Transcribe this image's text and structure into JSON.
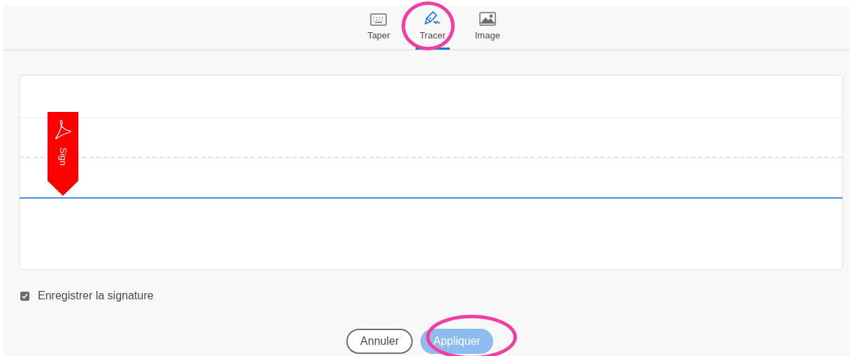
{
  "tabs": [
    {
      "label": "Taper",
      "kind": "keyboard",
      "selected": false
    },
    {
      "label": "Tracer",
      "kind": "pen",
      "selected": true
    },
    {
      "label": "Image",
      "kind": "image",
      "selected": false
    }
  ],
  "badge": {
    "label": "Sign"
  },
  "save_signature": {
    "label": "Enregistrer la signature",
    "checked": true
  },
  "buttons": [
    {
      "label": "Annuler",
      "kind": "secondary",
      "disabled": false
    },
    {
      "label": "Appliquer",
      "kind": "primary",
      "disabled": true
    }
  ]
}
